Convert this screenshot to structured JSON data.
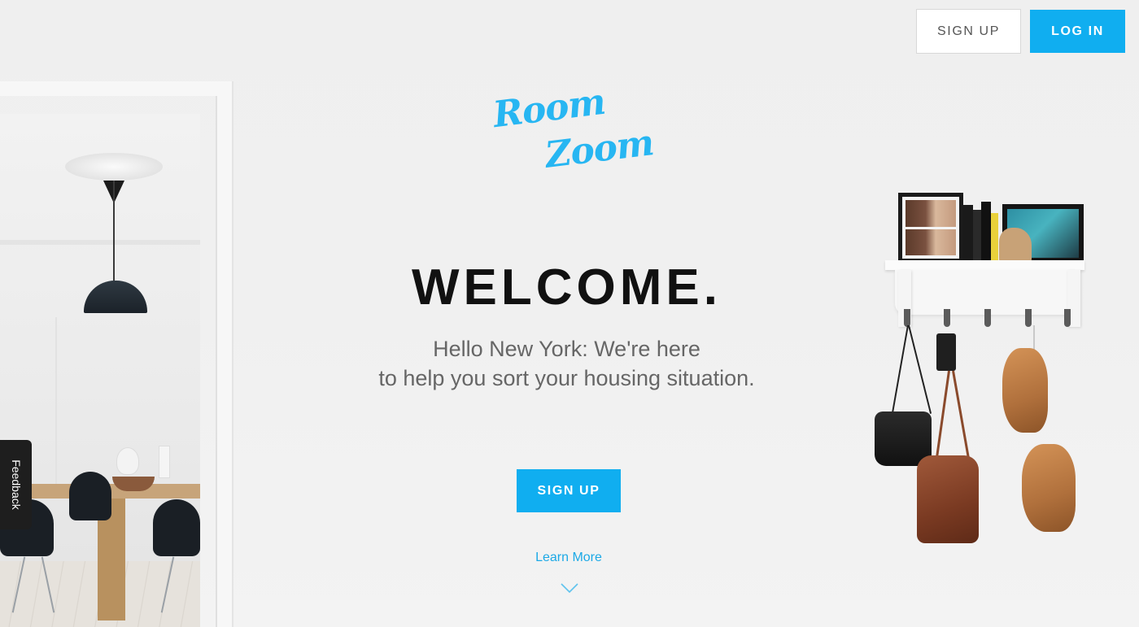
{
  "header": {
    "signup_label": "SIGN UP",
    "login_label": "LOG IN"
  },
  "logo": {
    "line1": "Room",
    "line2": "Zoom"
  },
  "hero": {
    "title": "WELCOME.",
    "subtitle_line1": "Hello New York: We're here",
    "subtitle_line2": "to help you sort your housing situation.",
    "cta_label": "SIGN UP",
    "learn_more": "Learn More"
  },
  "feedback": {
    "label": "Feedback"
  },
  "colors": {
    "accent": "#10aef0",
    "logo": "#27b6f2",
    "title": "#111111",
    "subtitle": "#666666"
  },
  "icons": {
    "scroll_down": "chevron-down-icon"
  }
}
